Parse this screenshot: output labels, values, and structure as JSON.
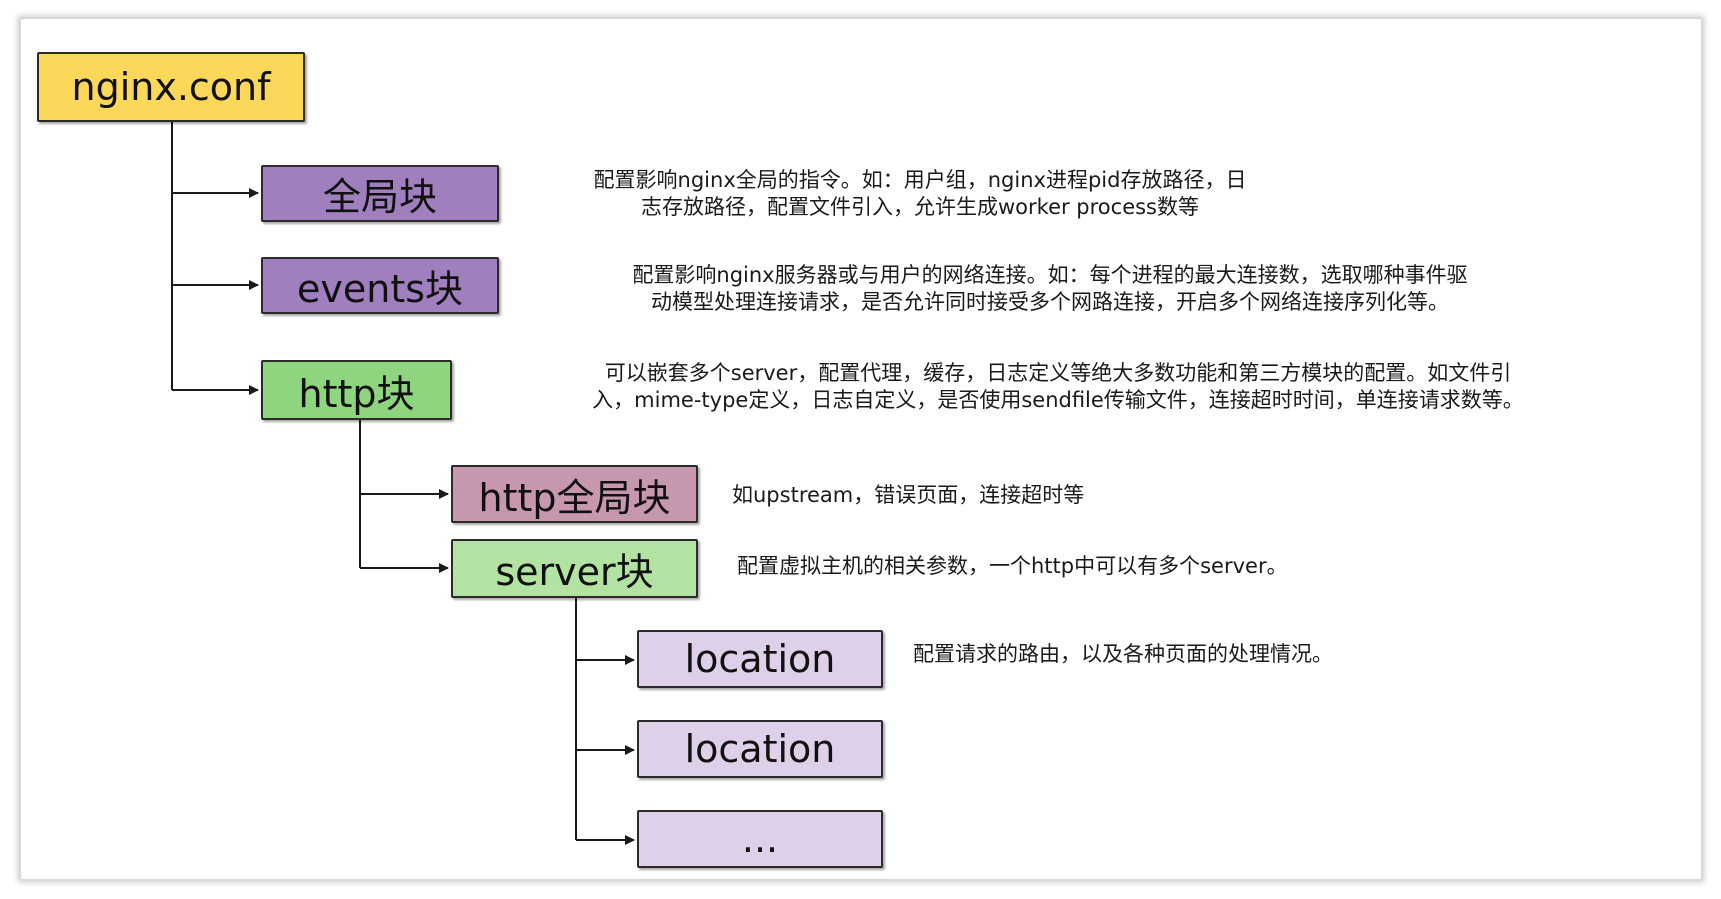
{
  "colors": {
    "root": "#fbd75a",
    "purple": "#a07fbe",
    "green": "#8fd47f",
    "pink": "#c797b0",
    "light_green": "#b2e3a3",
    "lavender": "#ddd0e8",
    "line": "#1a1a1a"
  },
  "nodes": {
    "root": "nginx.conf",
    "global": "全局块",
    "events": "events块",
    "http": "http块",
    "http_global": "http全局块",
    "server": "server块",
    "location1": "location",
    "location2": "location",
    "more": "..."
  },
  "descriptions": {
    "global": [
      "配置影响nginx全局的指令。如：用户组，nginx进程pid存放路径，日",
      "志存放路径，配置文件引入，允许生成worker process数等"
    ],
    "events": [
      "配置影响nginx服务器或与用户的网络连接。如：每个进程的最大连接数，选取哪种事件驱",
      "动模型处理连接请求，是否允许同时接受多个网路连接，开启多个网络连接序列化等。"
    ],
    "http": [
      "可以嵌套多个server，配置代理，缓存，日志定义等绝大多数功能和第三方模块的配置。如文件引",
      "入，mime-type定义，日志自定义，是否使用sendfile传输文件，连接超时时间，单连接请求数等。"
    ],
    "http_global": [
      "如upstream，错误页面，连接超时等"
    ],
    "server": [
      "配置虚拟主机的相关参数，一个http中可以有多个server。"
    ],
    "location": [
      "配置请求的路由，以及各种页面的处理情况。"
    ]
  }
}
